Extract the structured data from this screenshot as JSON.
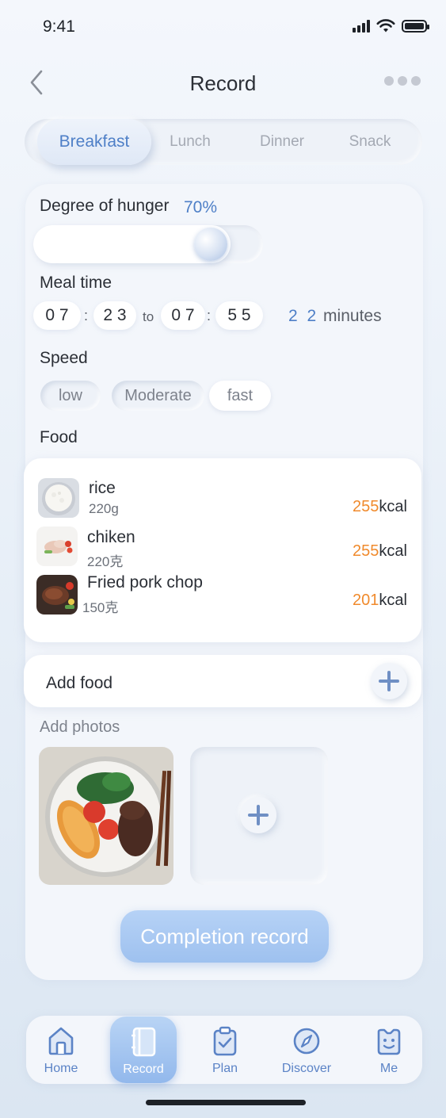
{
  "status_bar": {
    "time": "9:41"
  },
  "header": {
    "title": "Record"
  },
  "meal_tabs": [
    {
      "label": "Breakfast",
      "active": true
    },
    {
      "label": "Lunch",
      "active": false
    },
    {
      "label": "Dinner",
      "active": false
    },
    {
      "label": "Snack",
      "active": false
    }
  ],
  "hunger": {
    "label": "Degree of hunger",
    "value_text": "70%",
    "level": 0.7
  },
  "meal_time": {
    "label": "Meal time",
    "start": {
      "hour": "0 7",
      "minute": "2 3"
    },
    "to": "to",
    "end": {
      "hour": "0 7",
      "minute": "5 5"
    },
    "colon": ":",
    "duration": "2 2",
    "duration_unit": "minutes"
  },
  "speed": {
    "label": "Speed",
    "options": [
      "low",
      "Moderate",
      "fast"
    ]
  },
  "food": {
    "label": "Food",
    "items": [
      {
        "name": "rice",
        "weight": "220g",
        "kcal": "255",
        "unit": "kcal"
      },
      {
        "name": "chiken",
        "weight": "220克",
        "kcal": "255",
        "unit": "kcal"
      },
      {
        "name": "Fried pork chop",
        "weight": "150克",
        "kcal": "201",
        "unit": "kcal"
      }
    ]
  },
  "add_food": {
    "label": "Add food"
  },
  "photos": {
    "label": "Add photos"
  },
  "complete_button": {
    "label": "Completion record"
  },
  "tab_bar": [
    {
      "label": "Home",
      "icon": "home-icon",
      "active": false
    },
    {
      "label": "Record",
      "icon": "notebook-icon",
      "active": true
    },
    {
      "label": "Plan",
      "icon": "clipboard-check-icon",
      "active": false
    },
    {
      "label": "Discover",
      "icon": "compass-icon",
      "active": false
    },
    {
      "label": "Me",
      "icon": "smiley-face-icon",
      "active": false
    }
  ],
  "colors": {
    "accent": "#4e7fc7",
    "kcal": "#f08a2c",
    "button": "#9ec1ef"
  }
}
